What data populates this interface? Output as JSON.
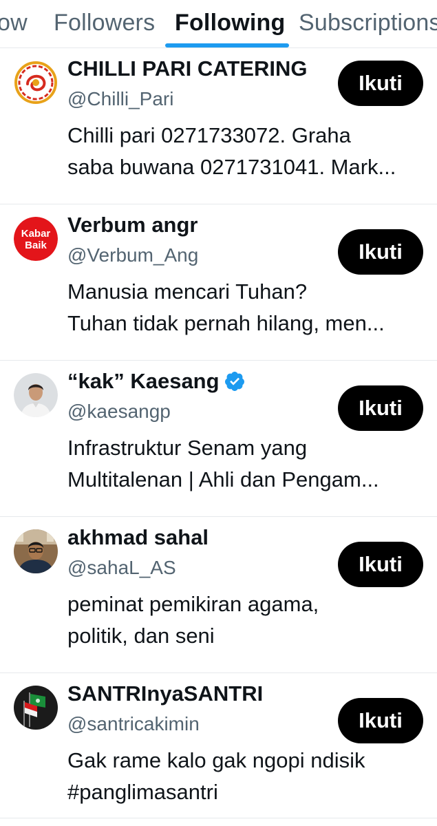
{
  "tabs": [
    {
      "label": "ow",
      "active": false
    },
    {
      "label": "Followers",
      "active": false
    },
    {
      "label": "Following",
      "active": true
    },
    {
      "label": "Subscriptions",
      "active": false
    }
  ],
  "colors": {
    "accent": "#1d9bf0",
    "text_primary": "#0f1419",
    "text_secondary": "#536471",
    "button_bg": "#000000",
    "button_text": "#ffffff",
    "divider": "#e6e9ec"
  },
  "accounts": [
    {
      "name": "CHILLI PARI CATERING",
      "handle": "@Chilli_Pari",
      "bio_lines": [
        "Chilli pari 0271733072. Graha",
        "saba buwana 0271731041. Mark..."
      ],
      "button_label": "Ikuti",
      "verified": false,
      "avatar_icon": "chilli-pari-logo-icon"
    },
    {
      "name": "Verbum angr",
      "handle": "@Verbum_Ang",
      "bio_lines": [
        "Manusia mencari Tuhan?",
        "Tuhan tidak pernah hilang, men..."
      ],
      "button_label": "Ikuti",
      "verified": false,
      "avatar_icon": "kabar-baik-logo-icon",
      "avatar_text": [
        "Kabar",
        "Baik"
      ]
    },
    {
      "name": "“kak” Kaesang",
      "handle": "@kaesangp",
      "bio_lines": [
        "Infrastruktur Senam yang",
        "Multitalenan | Ahli dan Pengam..."
      ],
      "button_label": "Ikuti",
      "verified": true,
      "avatar_icon": "person-photo-icon"
    },
    {
      "name": "akhmad sahal",
      "handle": "@sahaL_AS",
      "bio_lines": [
        "peminat pemikiran agama,",
        "politik,  dan seni"
      ],
      "button_label": "Ikuti",
      "verified": false,
      "avatar_icon": "person-photo-icon"
    },
    {
      "name": "SANTRInyaSANTRI",
      "handle": "@santricakimin",
      "bio_lines": [
        "Gak rame kalo gak ngopi ndisik",
        "#panglimasantri"
      ],
      "button_label": "Ikuti",
      "verified": false,
      "avatar_icon": "flags-icon"
    }
  ]
}
